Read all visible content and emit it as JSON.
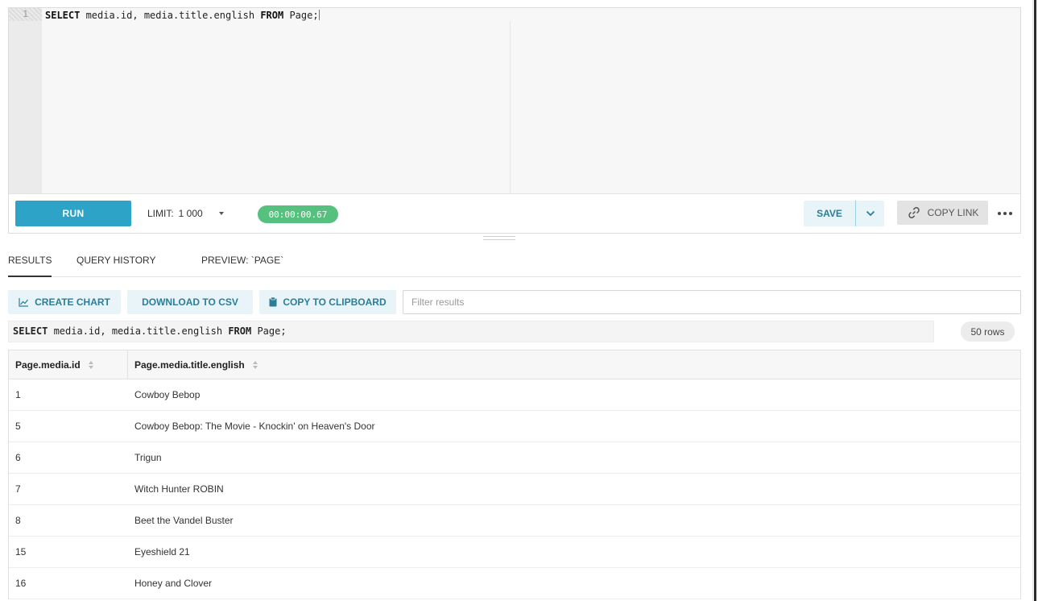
{
  "editor": {
    "line_number": "1",
    "query_parts": [
      {
        "text": "SELECT",
        "kw": true
      },
      {
        "text": " media.id, media.title.english ",
        "kw": false
      },
      {
        "text": "FROM",
        "kw": true
      },
      {
        "text": " Page;",
        "kw": false
      }
    ]
  },
  "toolbar": {
    "run_label": "RUN",
    "limit_label": "LIMIT:",
    "limit_value": "1 000",
    "elapsed_time": "00:00:00.67",
    "save_label": "SAVE",
    "copy_link_label": "COPY LINK"
  },
  "tabs": [
    {
      "label": "RESULTS",
      "active": true
    },
    {
      "label": "QUERY HISTORY",
      "active": false
    },
    {
      "label": "PREVIEW: `PAGE`",
      "active": false
    }
  ],
  "actions": {
    "create_chart": "CREATE CHART",
    "download_csv": "DOWNLOAD TO CSV",
    "copy_clipboard": "COPY TO CLIPBOARD",
    "filter_placeholder": "Filter results"
  },
  "results": {
    "query_parts": [
      {
        "text": "SELECT",
        "kw": true
      },
      {
        "text": " media.id, media.title.english ",
        "kw": false
      },
      {
        "text": "FROM",
        "kw": true
      },
      {
        "text": " Page;",
        "kw": false
      }
    ],
    "row_count": "50 rows",
    "columns": [
      "Page.media.id",
      "Page.media.title.english"
    ],
    "rows": [
      [
        "1",
        "Cowboy Bebop"
      ],
      [
        "5",
        "Cowboy Bebop: The Movie - Knockin' on Heaven's Door"
      ],
      [
        "6",
        "Trigun"
      ],
      [
        "7",
        "Witch Hunter ROBIN"
      ],
      [
        "8",
        "Beet the Vandel Buster"
      ],
      [
        "15",
        "Eyeshield 21"
      ],
      [
        "16",
        "Honey and Clover"
      ]
    ]
  },
  "colors": {
    "run_button": "#2ea3c8",
    "timer_badge": "#56c17e",
    "secondary_button_bg": "#e8f4f8",
    "secondary_button_text": "#2b7d98"
  }
}
